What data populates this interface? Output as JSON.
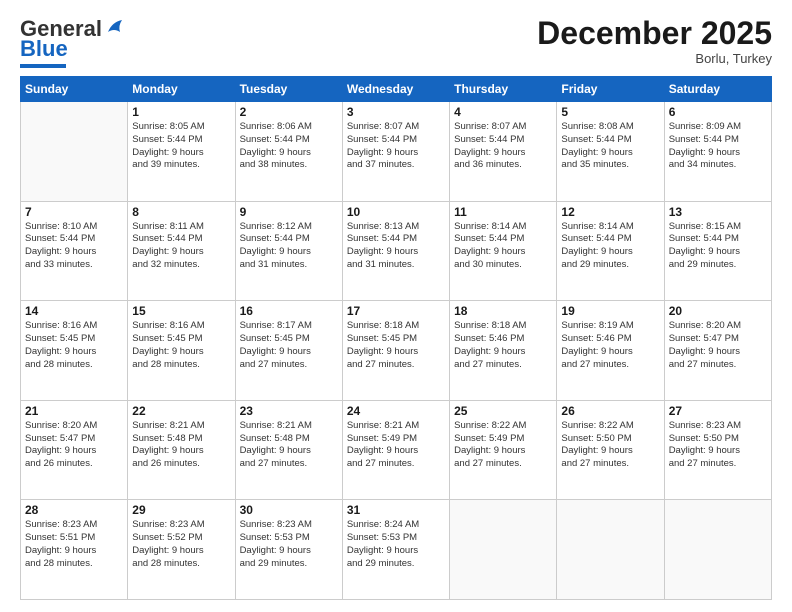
{
  "logo": {
    "general": "General",
    "blue": "Blue"
  },
  "header": {
    "month": "December 2025",
    "location": "Borlu, Turkey"
  },
  "weekdays": [
    "Sunday",
    "Monday",
    "Tuesday",
    "Wednesday",
    "Thursday",
    "Friday",
    "Saturday"
  ],
  "weeks": [
    [
      {
        "num": "",
        "info": ""
      },
      {
        "num": "1",
        "info": "Sunrise: 8:05 AM\nSunset: 5:44 PM\nDaylight: 9 hours\nand 39 minutes."
      },
      {
        "num": "2",
        "info": "Sunrise: 8:06 AM\nSunset: 5:44 PM\nDaylight: 9 hours\nand 38 minutes."
      },
      {
        "num": "3",
        "info": "Sunrise: 8:07 AM\nSunset: 5:44 PM\nDaylight: 9 hours\nand 37 minutes."
      },
      {
        "num": "4",
        "info": "Sunrise: 8:07 AM\nSunset: 5:44 PM\nDaylight: 9 hours\nand 36 minutes."
      },
      {
        "num": "5",
        "info": "Sunrise: 8:08 AM\nSunset: 5:44 PM\nDaylight: 9 hours\nand 35 minutes."
      },
      {
        "num": "6",
        "info": "Sunrise: 8:09 AM\nSunset: 5:44 PM\nDaylight: 9 hours\nand 34 minutes."
      }
    ],
    [
      {
        "num": "7",
        "info": "Sunrise: 8:10 AM\nSunset: 5:44 PM\nDaylight: 9 hours\nand 33 minutes."
      },
      {
        "num": "8",
        "info": "Sunrise: 8:11 AM\nSunset: 5:44 PM\nDaylight: 9 hours\nand 32 minutes."
      },
      {
        "num": "9",
        "info": "Sunrise: 8:12 AM\nSunset: 5:44 PM\nDaylight: 9 hours\nand 31 minutes."
      },
      {
        "num": "10",
        "info": "Sunrise: 8:13 AM\nSunset: 5:44 PM\nDaylight: 9 hours\nand 31 minutes."
      },
      {
        "num": "11",
        "info": "Sunrise: 8:14 AM\nSunset: 5:44 PM\nDaylight: 9 hours\nand 30 minutes."
      },
      {
        "num": "12",
        "info": "Sunrise: 8:14 AM\nSunset: 5:44 PM\nDaylight: 9 hours\nand 29 minutes."
      },
      {
        "num": "13",
        "info": "Sunrise: 8:15 AM\nSunset: 5:44 PM\nDaylight: 9 hours\nand 29 minutes."
      }
    ],
    [
      {
        "num": "14",
        "info": "Sunrise: 8:16 AM\nSunset: 5:45 PM\nDaylight: 9 hours\nand 28 minutes."
      },
      {
        "num": "15",
        "info": "Sunrise: 8:16 AM\nSunset: 5:45 PM\nDaylight: 9 hours\nand 28 minutes."
      },
      {
        "num": "16",
        "info": "Sunrise: 8:17 AM\nSunset: 5:45 PM\nDaylight: 9 hours\nand 27 minutes."
      },
      {
        "num": "17",
        "info": "Sunrise: 8:18 AM\nSunset: 5:45 PM\nDaylight: 9 hours\nand 27 minutes."
      },
      {
        "num": "18",
        "info": "Sunrise: 8:18 AM\nSunset: 5:46 PM\nDaylight: 9 hours\nand 27 minutes."
      },
      {
        "num": "19",
        "info": "Sunrise: 8:19 AM\nSunset: 5:46 PM\nDaylight: 9 hours\nand 27 minutes."
      },
      {
        "num": "20",
        "info": "Sunrise: 8:20 AM\nSunset: 5:47 PM\nDaylight: 9 hours\nand 27 minutes."
      }
    ],
    [
      {
        "num": "21",
        "info": "Sunrise: 8:20 AM\nSunset: 5:47 PM\nDaylight: 9 hours\nand 26 minutes."
      },
      {
        "num": "22",
        "info": "Sunrise: 8:21 AM\nSunset: 5:48 PM\nDaylight: 9 hours\nand 26 minutes."
      },
      {
        "num": "23",
        "info": "Sunrise: 8:21 AM\nSunset: 5:48 PM\nDaylight: 9 hours\nand 27 minutes."
      },
      {
        "num": "24",
        "info": "Sunrise: 8:21 AM\nSunset: 5:49 PM\nDaylight: 9 hours\nand 27 minutes."
      },
      {
        "num": "25",
        "info": "Sunrise: 8:22 AM\nSunset: 5:49 PM\nDaylight: 9 hours\nand 27 minutes."
      },
      {
        "num": "26",
        "info": "Sunrise: 8:22 AM\nSunset: 5:50 PM\nDaylight: 9 hours\nand 27 minutes."
      },
      {
        "num": "27",
        "info": "Sunrise: 8:23 AM\nSunset: 5:50 PM\nDaylight: 9 hours\nand 27 minutes."
      }
    ],
    [
      {
        "num": "28",
        "info": "Sunrise: 8:23 AM\nSunset: 5:51 PM\nDaylight: 9 hours\nand 28 minutes."
      },
      {
        "num": "29",
        "info": "Sunrise: 8:23 AM\nSunset: 5:52 PM\nDaylight: 9 hours\nand 28 minutes."
      },
      {
        "num": "30",
        "info": "Sunrise: 8:23 AM\nSunset: 5:53 PM\nDaylight: 9 hours\nand 29 minutes."
      },
      {
        "num": "31",
        "info": "Sunrise: 8:24 AM\nSunset: 5:53 PM\nDaylight: 9 hours\nand 29 minutes."
      },
      {
        "num": "",
        "info": ""
      },
      {
        "num": "",
        "info": ""
      },
      {
        "num": "",
        "info": ""
      }
    ]
  ]
}
